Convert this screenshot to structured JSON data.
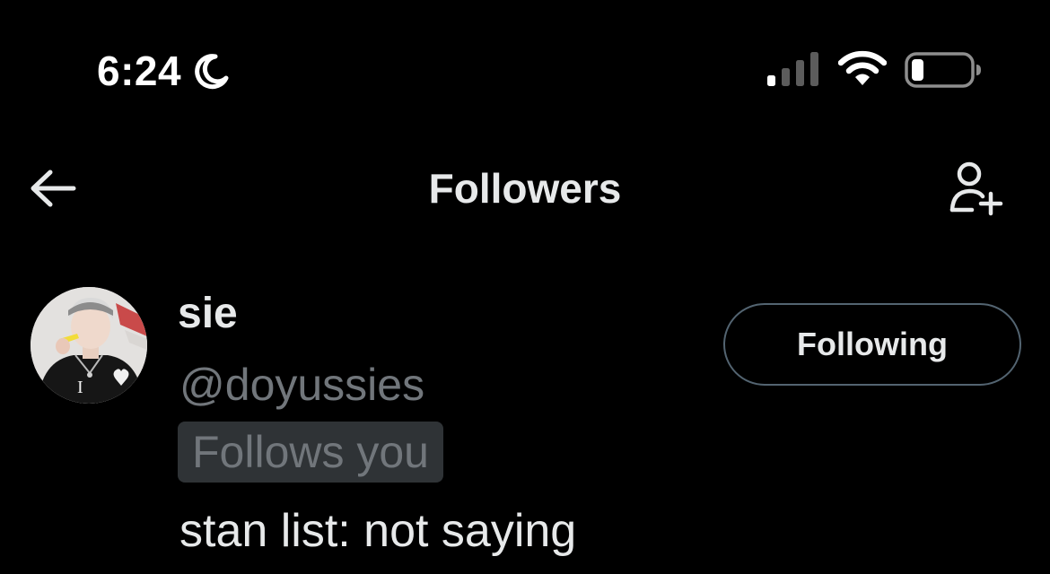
{
  "status_bar": {
    "time": "6:24",
    "icons": [
      "moon-icon",
      "signal-icon",
      "wifi-icon",
      "battery-icon"
    ]
  },
  "nav": {
    "title": "Followers",
    "back_icon": "arrow-left-icon",
    "action_icon": "add-person-icon"
  },
  "followers": [
    {
      "display_name": "sie",
      "handle": "@doyussies",
      "follows_you_label": "Follows you",
      "bio": "stan list: not saying",
      "button_label": "Following"
    }
  ],
  "colors": {
    "background": "#000000",
    "primary_text": "#e7e9ea",
    "secondary_text": "#71767b",
    "badge_background": "#2f3336",
    "button_border": "#536471"
  }
}
